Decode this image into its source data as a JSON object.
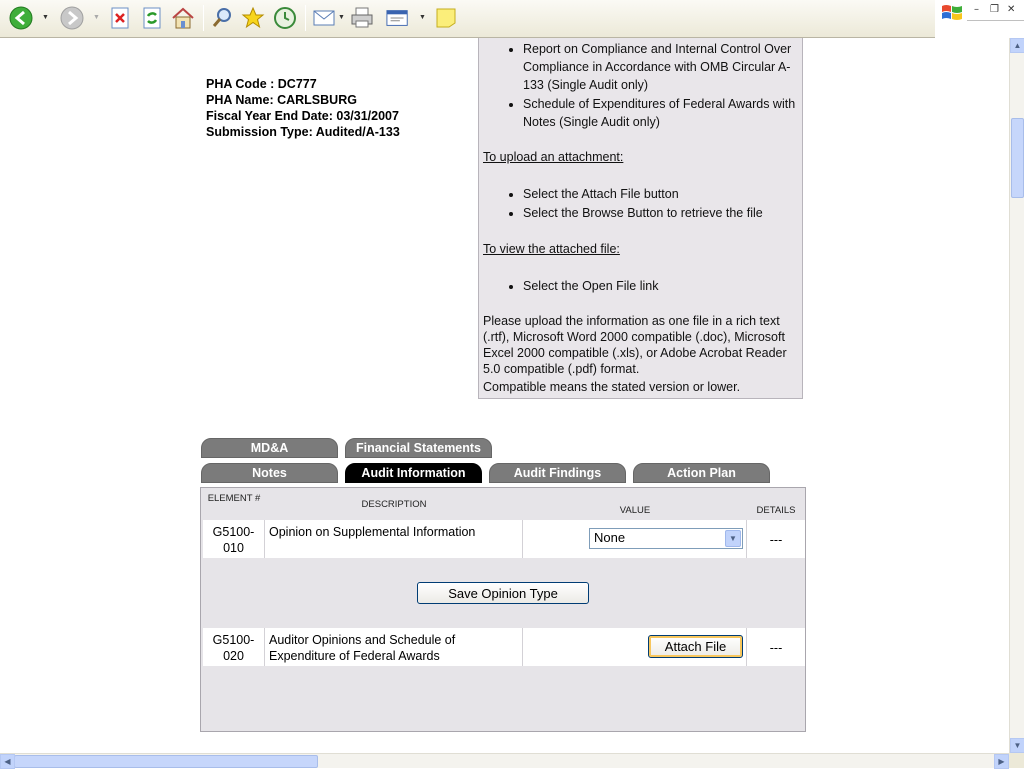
{
  "toolbar": {
    "buttons": [
      "back-icon",
      "forward-icon",
      "stop-icon",
      "refresh-icon",
      "home-icon",
      "search-icon",
      "favorites-icon",
      "history-icon",
      "mail-icon",
      "print-icon",
      "edit-icon",
      "note-icon"
    ]
  },
  "pha": {
    "code": "PHA Code : DC777",
    "name": "PHA Name: CARLSBURG",
    "fiscal_year_end": "Fiscal Year End Date: 03/31/2007",
    "submission_type": "Submission Type: Audited/A-133"
  },
  "instructions": {
    "required_items": [
      "Report on Compliance and Internal Control Over Compliance in Accordance with OMB Circular A-133 (Single Audit only)",
      "Schedule of Expenditures of Federal Awards with Notes (Single Audit only)"
    ],
    "upload_heading": "To upload an attachment:",
    "upload_steps": [
      "Select the Attach File button",
      "Select the Browse Button to retrieve the file"
    ],
    "view_heading": "To view the attached file:",
    "view_steps": [
      "Select the Open File link"
    ],
    "format_note": "Please upload the information as one file in a rich text (.rtf), Microsoft Word 2000 compatible (.doc), Microsoft Excel 2000 compatible (.xls), or Adobe Acrobat Reader 5.0 compatible (.pdf) format.",
    "compat_note": "Compatible means the stated version or lower."
  },
  "tabs": {
    "row1": [
      "MD&A",
      "Financial Statements"
    ],
    "row2": [
      "Notes",
      "Audit Information",
      "Audit Findings",
      "Action Plan"
    ],
    "active": "Audit Information"
  },
  "table": {
    "headers": {
      "element": "ELEMENT #",
      "description": "DESCRIPTION",
      "value": "VALUE",
      "details": "DETAILS"
    },
    "rows": [
      {
        "element": "G5100-010",
        "element_line1": "G5100-",
        "element_line2": "010",
        "description": "Opinion on Supplemental Information",
        "value": "None",
        "details": "---"
      },
      {
        "element": "G5100-020",
        "element_line1": "G5100-",
        "element_line2": "020",
        "description": "Auditor Opinions and Schedule of Expenditure of Federal Awards",
        "value_button": "Attach File",
        "details": "---"
      }
    ],
    "save_button": "Save Opinion Type"
  },
  "colors": {
    "tab_active": "#000000",
    "tab_inactive": "#7b7b7b",
    "panel_bg": "#e9e6ea",
    "table_bg": "#e6e4e8"
  }
}
